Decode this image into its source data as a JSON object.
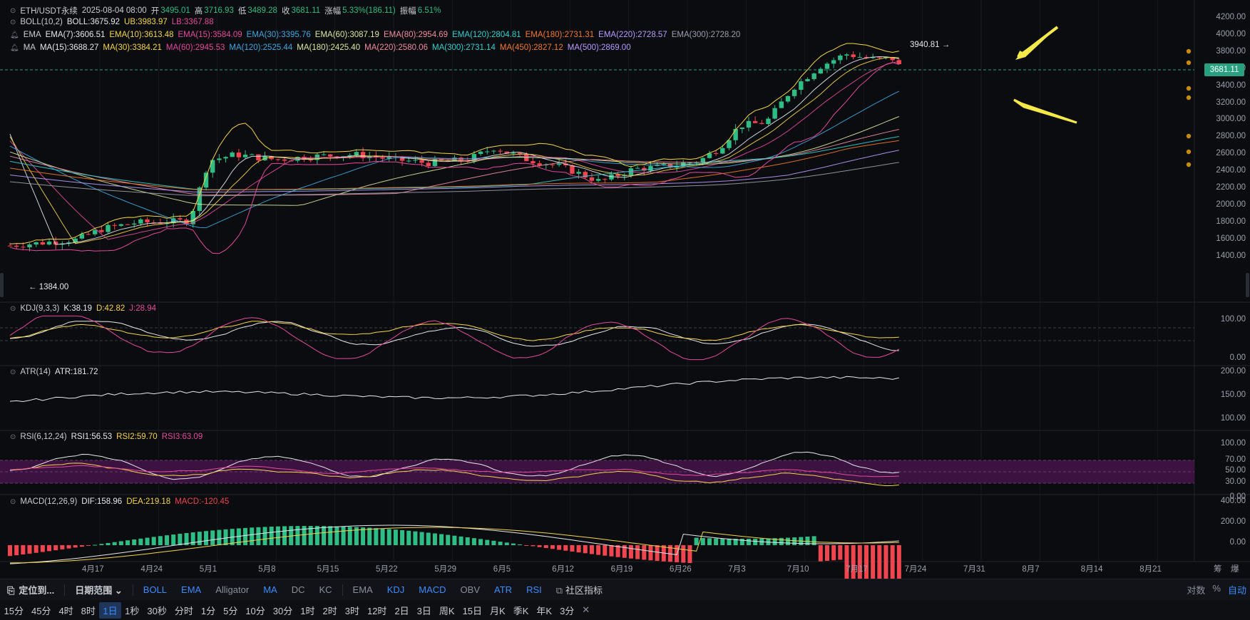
{
  "header": {
    "symbol": "ETH/USDT永续",
    "date": "2025-08-04 08:00",
    "open_label": "开",
    "open": "3495.01",
    "high_label": "高",
    "high": "3716.93",
    "low_label": "低",
    "low": "3489.28",
    "close_label": "收",
    "close": "3681.11",
    "change_label": "涨幅",
    "change": "5.33%(186.11)",
    "amp_label": "振幅",
    "amp": "6.51%"
  },
  "boll": {
    "name": "BOLL(10,2)",
    "items": [
      {
        "t": "BOLL:3675.92",
        "c": "#e6e8ec"
      },
      {
        "t": "UB:3983.97",
        "c": "#f5d547"
      },
      {
        "t": "LB:3367.88",
        "c": "#e44a9b"
      }
    ]
  },
  "ema": {
    "name": "EMA",
    "items": [
      {
        "t": "EMA(7):3606.51",
        "c": "#e6e8ec"
      },
      {
        "t": "EMA(10):3613.48",
        "c": "#f5d547"
      },
      {
        "t": "EMA(15):3584.09",
        "c": "#e44a9b"
      },
      {
        "t": "EMA(30):3395.76",
        "c": "#3fa7e0"
      },
      {
        "t": "EMA(60):3087.19",
        "c": "#d9e8a0"
      },
      {
        "t": "EMA(80):2954.69",
        "c": "#f08ca0"
      },
      {
        "t": "EMA(120):2804.81",
        "c": "#2fd1d1"
      },
      {
        "t": "EMA(180):2731.31",
        "c": "#f07a2a"
      },
      {
        "t": "EMA(220):2728.57",
        "c": "#b89cff"
      },
      {
        "t": "EMA(300):2728.20",
        "c": "#9aa0ab"
      }
    ]
  },
  "ma": {
    "name": "MA",
    "items": [
      {
        "t": "MA(15):3688.27",
        "c": "#e6e8ec"
      },
      {
        "t": "MA(30):3384.21",
        "c": "#f5d547"
      },
      {
        "t": "MA(60):2945.53",
        "c": "#e44a9b"
      },
      {
        "t": "MA(120):2525.44",
        "c": "#3fa7e0"
      },
      {
        "t": "MA(180):2425.40",
        "c": "#d9e8a0"
      },
      {
        "t": "MA(220):2580.06",
        "c": "#f08ca0"
      },
      {
        "t": "MA(300):2731.14",
        "c": "#2fd1d1"
      },
      {
        "t": "MA(450):2827.12",
        "c": "#f07a2a"
      },
      {
        "t": "MA(500):2869.00",
        "c": "#b89cff"
      }
    ]
  },
  "price_axis": [
    "4200.00",
    "4000.00",
    "3800.00",
    "3600.00",
    "3400.00",
    "3200.00",
    "3000.00",
    "2800.00",
    "2600.00",
    "2400.00",
    "2200.00",
    "2000.00",
    "1800.00",
    "1600.00",
    "1400.00"
  ],
  "price_tag": "3681.11",
  "high_marker": "3940.81 →",
  "low_marker": "← 1384.00",
  "kdj": {
    "name": "KDJ(9,3,3)",
    "items": [
      {
        "t": "K:38.19",
        "c": "#e6e8ec"
      },
      {
        "t": "D:42.82",
        "c": "#f5d547"
      },
      {
        "t": "J:28.94",
        "c": "#e44a9b"
      }
    ],
    "axis": [
      "100.00",
      "0.00"
    ]
  },
  "atr": {
    "name": "ATR(14)",
    "items": [
      {
        "t": "ATR:181.72",
        "c": "#e6e8ec"
      }
    ],
    "axis": [
      "200.00",
      "150.00",
      "100.00"
    ]
  },
  "rsi": {
    "name": "RSI(6,12,24)",
    "items": [
      {
        "t": "RSI1:56.53",
        "c": "#e6e8ec"
      },
      {
        "t": "RSI2:59.70",
        "c": "#f5d547"
      },
      {
        "t": "RSI3:63.09",
        "c": "#e44a9b"
      }
    ],
    "axis": [
      "100.00",
      "70.00",
      "50.00",
      "30.00",
      "0.00"
    ]
  },
  "macd": {
    "name": "MACD(12,26,9)",
    "items": [
      {
        "t": "DIF:158.96",
        "c": "#e6e8ec"
      },
      {
        "t": "DEA:219.18",
        "c": "#f5d547"
      },
      {
        "t": "MACD:-120.45",
        "c": "#f0444f"
      }
    ],
    "axis": [
      "400.00",
      "200.00",
      "0.00"
    ]
  },
  "x_axis": [
    "4月17",
    "4月24",
    "5月1",
    "5月8",
    "5月15",
    "5月22",
    "5月29",
    "6月5",
    "6月12",
    "6月19",
    "6月26",
    "7月3",
    "7月10",
    "7月17",
    "7月24",
    "7月31",
    "8月7",
    "8月14",
    "8月21"
  ],
  "x_right": [
    "筹",
    "爆"
  ],
  "toolbar1": {
    "locate": "定位到...",
    "range": "日期范围",
    "indicators": [
      {
        "t": "BOLL",
        "on": true
      },
      {
        "t": "EMA",
        "on": true
      },
      {
        "t": "Alligator",
        "on": false
      },
      {
        "t": "MA",
        "on": true
      },
      {
        "t": "DC",
        "on": false
      },
      {
        "t": "KC",
        "on": false
      }
    ],
    "sub": [
      {
        "t": "EMA",
        "on": false
      },
      {
        "t": "KDJ",
        "on": true
      },
      {
        "t": "MACD",
        "on": true
      },
      {
        "t": "OBV",
        "on": false
      },
      {
        "t": "ATR",
        "on": true
      },
      {
        "t": "RSI",
        "on": true
      }
    ],
    "community": "社区指标",
    "right": [
      {
        "t": "对数",
        "on": false
      },
      {
        "t": "%",
        "on": false
      },
      {
        "t": "自动",
        "on": true
      }
    ]
  },
  "toolbar2": {
    "items": [
      "15分",
      "45分",
      "4时",
      "8时",
      "1日",
      "1秒",
      "30秒",
      "分时",
      "1分",
      "5分",
      "10分",
      "30分",
      "1时",
      "2时",
      "3时",
      "12时",
      "2日",
      "3日",
      "周K",
      "15日",
      "月K",
      "季K",
      "年K",
      "3分"
    ],
    "selected": "1日",
    "close": "✕"
  },
  "colors": {
    "up": "#2ebd85",
    "down": "#f0444f",
    "accent": "#3b8cff",
    "arrow": "#f5e94a"
  }
}
